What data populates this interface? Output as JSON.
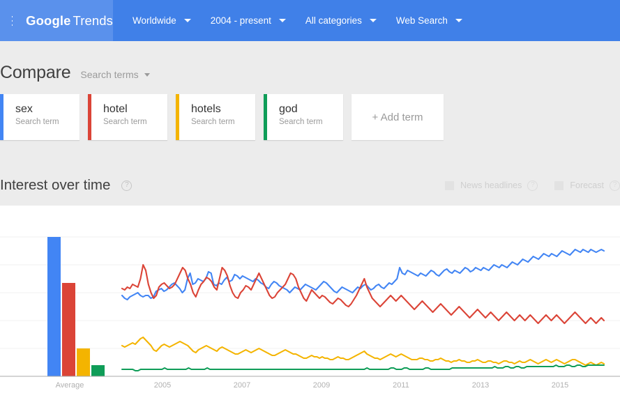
{
  "header": {
    "menu_icon": "hamburger-icon",
    "brand_primary": "Google",
    "brand_secondary": "Trends",
    "nav": [
      {
        "label": "Worldwide",
        "icon": "chevron-down-icon"
      },
      {
        "label": "2004 - present",
        "icon": "chevron-down-icon"
      },
      {
        "label": "All categories",
        "icon": "chevron-down-icon"
      },
      {
        "label": "Web Search",
        "icon": "chevron-down-icon"
      }
    ],
    "bar_color": "#4080e8",
    "brand_block_color": "#5a91ec"
  },
  "compare": {
    "title": "Compare",
    "type_selector": "Search terms",
    "type_selector_icon": "chevron-down-icon",
    "cards": [
      {
        "term": "sex",
        "subtitle": "Search term",
        "color": "#4285f4"
      },
      {
        "term": "hotel",
        "subtitle": "Search term",
        "color": "#db4437"
      },
      {
        "term": "hotels",
        "subtitle": "Search term",
        "color": "#f4b400"
      },
      {
        "term": "god",
        "subtitle": "Search term",
        "color": "#0f9d58"
      }
    ],
    "add_term_label": "+ Add term"
  },
  "interest": {
    "title": "Interest over time",
    "help_icon": "help-icon",
    "help_glyph": "?",
    "options": [
      {
        "label": "News headlines",
        "checked": false,
        "disabled": true,
        "help_glyph": "?"
      },
      {
        "label": "Forecast",
        "checked": false,
        "disabled": true,
        "help_glyph": "?"
      }
    ]
  },
  "chart_data": {
    "type": "line",
    "title": "Interest over time",
    "xlabel": "",
    "ylabel": "",
    "ylim": [
      0,
      100
    ],
    "grid": true,
    "legend": "none",
    "average_panel": {
      "type": "bar",
      "label": "Average",
      "categories": [
        "sex",
        "hotel",
        "hotels",
        "god"
      ],
      "values": [
        100,
        67,
        20,
        8
      ],
      "colors": [
        "#4285f4",
        "#db4437",
        "#f4b400",
        "#0f9d58"
      ]
    },
    "x_tick_labels": [
      "Average",
      "2005",
      "2007",
      "2009",
      "2011",
      "2013",
      "2015"
    ],
    "x_tick_positions": [
      100,
      233,
      347,
      461,
      575,
      689,
      803
    ],
    "gridline_values": [
      100,
      80,
      60,
      40,
      20
    ],
    "series": [
      {
        "name": "sex",
        "color": "#4285f4",
        "values": [
          58,
          56,
          55,
          57,
          58,
          59,
          60,
          58,
          57,
          58,
          58,
          56,
          57,
          61,
          62,
          63,
          61,
          62,
          64,
          66,
          67,
          65,
          63,
          60,
          62,
          70,
          74,
          66,
          67,
          70,
          69,
          68,
          70,
          75,
          74,
          66,
          65,
          67,
          66,
          69,
          71,
          68,
          69,
          73,
          72,
          70,
          72,
          71,
          70,
          69,
          68,
          70,
          69,
          67,
          66,
          64,
          63,
          66,
          68,
          67,
          65,
          64,
          63,
          62,
          60,
          62,
          64,
          63,
          62,
          64,
          66,
          65,
          64,
          63,
          62,
          64,
          66,
          68,
          67,
          65,
          63,
          61,
          60,
          62,
          64,
          63,
          62,
          61,
          60,
          62,
          64,
          63,
          65,
          66,
          64,
          62,
          63,
          65,
          66,
          64,
          63,
          65,
          67,
          66,
          68,
          70,
          78,
          74,
          73,
          76,
          75,
          74,
          73,
          72,
          74,
          73,
          72,
          74,
          76,
          75,
          73,
          72,
          74,
          76,
          77,
          75,
          74,
          76,
          75,
          74,
          76,
          78,
          77,
          75,
          76,
          78,
          77,
          76,
          78,
          77,
          76,
          78,
          80,
          79,
          78,
          80,
          79,
          78,
          80,
          82,
          81,
          80,
          82,
          84,
          83,
          82,
          84,
          86,
          85,
          84,
          86,
          88,
          87,
          86,
          88,
          87,
          86,
          88,
          90,
          89,
          88,
          87,
          89,
          91,
          90,
          89,
          91,
          90,
          89,
          91,
          90,
          89,
          90,
          91,
          90
        ]
      },
      {
        "name": "hotel",
        "color": "#db4437",
        "values": [
          63,
          62,
          64,
          63,
          66,
          65,
          64,
          70,
          80,
          76,
          66,
          60,
          56,
          58,
          64,
          66,
          67,
          65,
          63,
          64,
          66,
          70,
          74,
          78,
          76,
          70,
          66,
          60,
          57,
          62,
          66,
          68,
          71,
          70,
          68,
          64,
          62,
          70,
          78,
          76,
          72,
          65,
          60,
          57,
          56,
          60,
          62,
          65,
          64,
          62,
          66,
          70,
          74,
          70,
          66,
          62,
          58,
          56,
          57,
          60,
          62,
          64,
          66,
          70,
          74,
          73,
          70,
          64,
          60,
          56,
          54,
          58,
          62,
          60,
          58,
          56,
          58,
          57,
          55,
          53,
          52,
          54,
          56,
          55,
          53,
          51,
          50,
          52,
          55,
          58,
          62,
          66,
          70,
          64,
          60,
          56,
          54,
          52,
          50,
          52,
          54,
          56,
          58,
          56,
          54,
          56,
          58,
          56,
          54,
          52,
          50,
          48,
          50,
          52,
          54,
          52,
          50,
          48,
          46,
          48,
          50,
          52,
          50,
          48,
          46,
          44,
          46,
          48,
          50,
          48,
          46,
          44,
          42,
          44,
          46,
          48,
          46,
          44,
          42,
          44,
          46,
          44,
          42,
          40,
          42,
          44,
          46,
          44,
          42,
          40,
          42,
          44,
          42,
          40,
          42,
          44,
          42,
          40,
          38,
          40,
          42,
          44,
          42,
          40,
          42,
          44,
          42,
          40,
          38,
          40,
          42,
          44,
          46,
          44,
          42,
          40,
          38,
          40,
          42,
          40,
          38,
          40,
          42,
          40
        ]
      },
      {
        "name": "hotels",
        "color": "#f4b400",
        "values": [
          22,
          21,
          22,
          23,
          24,
          23,
          25,
          27,
          28,
          26,
          24,
          22,
          19,
          18,
          20,
          22,
          23,
          22,
          21,
          22,
          23,
          24,
          25,
          24,
          23,
          22,
          20,
          18,
          17,
          19,
          20,
          21,
          22,
          21,
          20,
          19,
          18,
          20,
          21,
          20,
          19,
          18,
          17,
          16,
          16,
          17,
          18,
          19,
          18,
          17,
          18,
          19,
          20,
          19,
          18,
          17,
          16,
          15,
          15,
          16,
          17,
          18,
          19,
          18,
          17,
          16,
          16,
          15,
          14,
          13,
          13,
          14,
          15,
          14,
          14,
          13,
          14,
          13,
          13,
          12,
          12,
          13,
          14,
          13,
          13,
          12,
          12,
          13,
          14,
          15,
          16,
          17,
          18,
          16,
          15,
          14,
          13,
          13,
          12,
          13,
          14,
          15,
          16,
          15,
          14,
          15,
          16,
          15,
          14,
          13,
          12,
          12,
          12,
          13,
          13,
          12,
          12,
          11,
          11,
          12,
          12,
          13,
          12,
          11,
          11,
          10,
          11,
          11,
          12,
          11,
          11,
          10,
          10,
          11,
          11,
          12,
          11,
          10,
          10,
          11,
          11,
          10,
          10,
          9,
          10,
          11,
          11,
          10,
          10,
          9,
          10,
          11,
          10,
          10,
          11,
          12,
          11,
          10,
          9,
          10,
          11,
          12,
          11,
          10,
          11,
          12,
          11,
          10,
          9,
          10,
          11,
          12,
          12,
          11,
          10,
          9,
          8,
          9,
          10,
          9,
          8,
          9,
          10,
          9
        ]
      },
      {
        "name": "god",
        "color": "#0f9d58",
        "values": [
          5,
          5,
          5,
          5,
          5,
          4,
          4,
          5,
          5,
          5,
          5,
          5,
          5,
          5,
          5,
          5,
          6,
          5,
          5,
          5,
          5,
          5,
          5,
          5,
          5,
          6,
          5,
          5,
          5,
          5,
          5,
          5,
          6,
          5,
          5,
          5,
          5,
          5,
          5,
          5,
          5,
          5,
          5,
          5,
          5,
          5,
          5,
          5,
          5,
          5,
          5,
          5,
          5,
          5,
          5,
          5,
          5,
          5,
          5,
          5,
          5,
          5,
          5,
          5,
          5,
          5,
          5,
          5,
          5,
          5,
          5,
          5,
          5,
          5,
          5,
          5,
          5,
          5,
          5,
          5,
          5,
          5,
          5,
          5,
          5,
          5,
          5,
          5,
          5,
          5,
          5,
          5,
          6,
          5,
          5,
          5,
          5,
          5,
          5,
          5,
          5,
          6,
          6,
          5,
          5,
          5,
          6,
          6,
          5,
          5,
          5,
          5,
          5,
          5,
          6,
          6,
          5,
          5,
          5,
          5,
          5,
          5,
          5,
          5,
          6,
          6,
          6,
          6,
          6,
          6,
          6,
          6,
          6,
          6,
          6,
          6,
          6,
          6,
          6,
          6,
          7,
          6,
          6,
          6,
          7,
          7,
          6,
          6,
          7,
          7,
          6,
          6,
          7,
          7,
          7,
          7,
          7,
          7,
          7,
          7,
          7,
          7,
          7,
          8,
          7,
          7,
          7,
          8,
          8,
          7,
          7,
          8,
          8,
          7,
          7,
          8,
          8,
          8,
          8,
          8,
          8,
          8
        ]
      }
    ]
  }
}
